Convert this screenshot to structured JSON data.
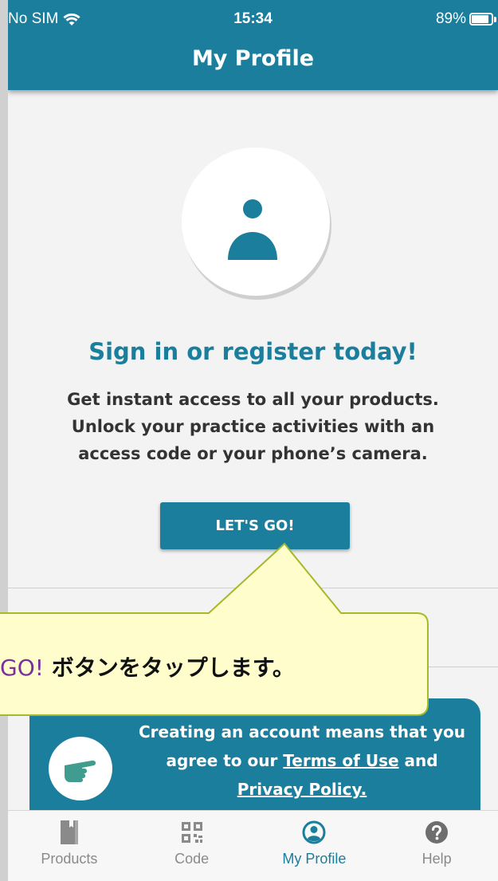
{
  "status_bar": {
    "carrier": "No SIM",
    "time": "15:34",
    "battery": "89%",
    "battery_level": 0.89
  },
  "header": {
    "title": "My Profile"
  },
  "profile": {
    "heading": "Sign in or register today!",
    "description_lines": [
      "Get instant access to all your products.",
      "Unlock your practice activities with an",
      "access code or your phone’s camera."
    ],
    "cta_label": "LET'S GO!"
  },
  "info_card": {
    "text_before": "Creating an account means that you agree to our ",
    "terms_label": "Terms of Use",
    "text_and": " and ",
    "privacy_label": "Privacy Policy."
  },
  "tabs": [
    {
      "label": "Products",
      "icon": "book-icon",
      "active": false
    },
    {
      "label": "Code",
      "icon": "qr-code-icon",
      "active": false
    },
    {
      "label": "My Profile",
      "icon": "user-circle-icon",
      "active": true
    },
    {
      "label": "Help",
      "icon": "help-circle-icon",
      "active": false
    }
  ],
  "tooltip": {
    "highlight": "GO!",
    "text": " ボタンをタップします。"
  },
  "colors": {
    "primary": "#1a7e9c",
    "tooltip_bg": "#fefdcb",
    "tooltip_border": "#a6b92a"
  }
}
